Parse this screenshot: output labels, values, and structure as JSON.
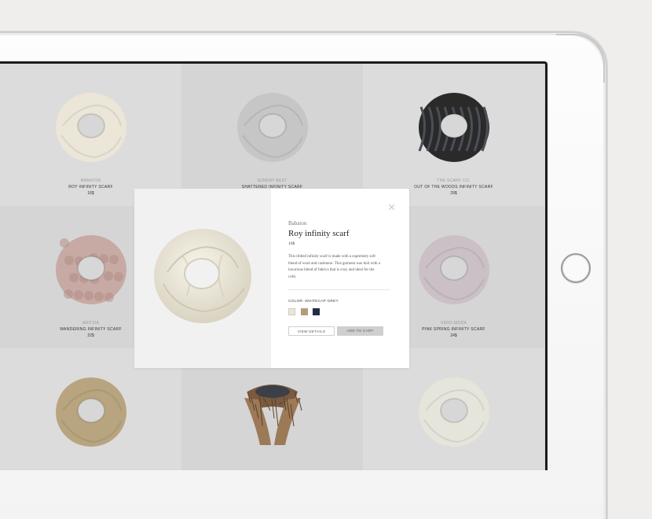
{
  "products": [
    {
      "brand": "Babaton",
      "name": "Roy infinity scarf",
      "price": "16$",
      "color": "#ebe6d8",
      "style": "knit"
    },
    {
      "brand": "Sunday Best",
      "name": "Shattered infinity scarf",
      "price": "",
      "color": "#c6c6c6",
      "style": "knit"
    },
    {
      "brand": "The Scarf Co.",
      "name": "Out of the woods infinity scarf",
      "price": "29$",
      "color": "#2a2a2a",
      "style": "stripe"
    },
    {
      "brand": "Aritzia",
      "name": "Wandering infinity scarf",
      "price": "22$",
      "color": "#c7aaa4",
      "style": "fur"
    },
    {
      "brand": "",
      "name": "",
      "price": "",
      "color": "",
      "style": ""
    },
    {
      "brand": "Vero Moda",
      "name": "Pink spring infinity scarf",
      "price": "24$",
      "color": "#cbc0c6",
      "style": "knit"
    },
    {
      "brand": "",
      "name": "",
      "price": "",
      "color": "#b8a57f",
      "style": "knit"
    },
    {
      "brand": "",
      "name": "",
      "price": "",
      "color": "#9c7a57",
      "style": "fur-collar"
    },
    {
      "brand": "",
      "name": "",
      "price": "",
      "color": "#e6e5db",
      "style": "knit"
    }
  ],
  "modal": {
    "brand": "Babaton",
    "title": "Roy infinity scarf",
    "price": "16$",
    "description": "This ribbed infinity scarf is made with a supremely soft blend of wool and cashmere. This garment was knit with a luxurious blend of fabrics that is cozy and ideal for the cold.",
    "color_label": "Color: Whitecap Grey",
    "swatches": [
      "#ebe6dc",
      "#b39e7c",
      "#232c47"
    ],
    "view_details": "View Details",
    "add_to_cart": "Add to Cart",
    "close_icon": "close-icon"
  }
}
